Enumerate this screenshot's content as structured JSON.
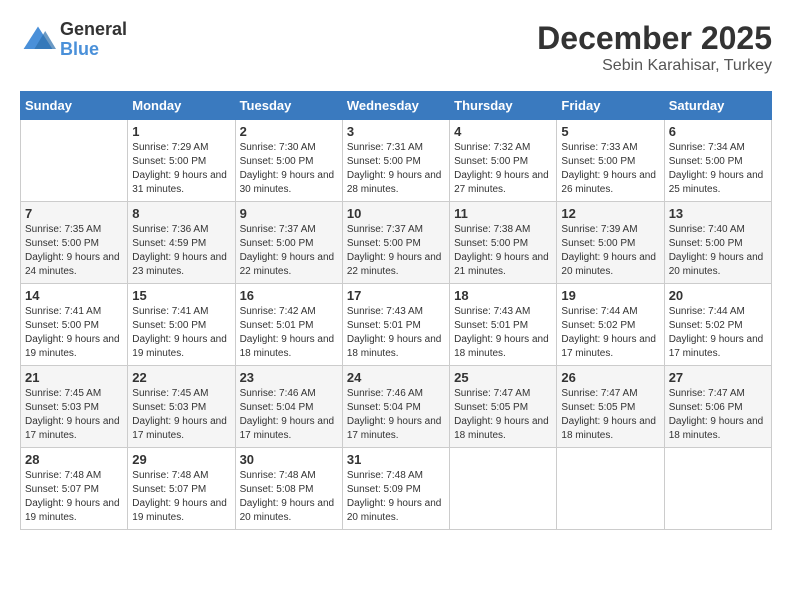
{
  "header": {
    "logo_general": "General",
    "logo_blue": "Blue",
    "title": "December 2025",
    "subtitle": "Sebin Karahisar, Turkey"
  },
  "weekdays": [
    "Sunday",
    "Monday",
    "Tuesday",
    "Wednesday",
    "Thursday",
    "Friday",
    "Saturday"
  ],
  "weeks": [
    [
      {
        "day": "",
        "sunrise": "",
        "sunset": "",
        "daylight": ""
      },
      {
        "day": "1",
        "sunrise": "Sunrise: 7:29 AM",
        "sunset": "Sunset: 5:00 PM",
        "daylight": "Daylight: 9 hours and 31 minutes."
      },
      {
        "day": "2",
        "sunrise": "Sunrise: 7:30 AM",
        "sunset": "Sunset: 5:00 PM",
        "daylight": "Daylight: 9 hours and 30 minutes."
      },
      {
        "day": "3",
        "sunrise": "Sunrise: 7:31 AM",
        "sunset": "Sunset: 5:00 PM",
        "daylight": "Daylight: 9 hours and 28 minutes."
      },
      {
        "day": "4",
        "sunrise": "Sunrise: 7:32 AM",
        "sunset": "Sunset: 5:00 PM",
        "daylight": "Daylight: 9 hours and 27 minutes."
      },
      {
        "day": "5",
        "sunrise": "Sunrise: 7:33 AM",
        "sunset": "Sunset: 5:00 PM",
        "daylight": "Daylight: 9 hours and 26 minutes."
      },
      {
        "day": "6",
        "sunrise": "Sunrise: 7:34 AM",
        "sunset": "Sunset: 5:00 PM",
        "daylight": "Daylight: 9 hours and 25 minutes."
      }
    ],
    [
      {
        "day": "7",
        "sunrise": "Sunrise: 7:35 AM",
        "sunset": "Sunset: 5:00 PM",
        "daylight": "Daylight: 9 hours and 24 minutes."
      },
      {
        "day": "8",
        "sunrise": "Sunrise: 7:36 AM",
        "sunset": "Sunset: 4:59 PM",
        "daylight": "Daylight: 9 hours and 23 minutes."
      },
      {
        "day": "9",
        "sunrise": "Sunrise: 7:37 AM",
        "sunset": "Sunset: 5:00 PM",
        "daylight": "Daylight: 9 hours and 22 minutes."
      },
      {
        "day": "10",
        "sunrise": "Sunrise: 7:37 AM",
        "sunset": "Sunset: 5:00 PM",
        "daylight": "Daylight: 9 hours and 22 minutes."
      },
      {
        "day": "11",
        "sunrise": "Sunrise: 7:38 AM",
        "sunset": "Sunset: 5:00 PM",
        "daylight": "Daylight: 9 hours and 21 minutes."
      },
      {
        "day": "12",
        "sunrise": "Sunrise: 7:39 AM",
        "sunset": "Sunset: 5:00 PM",
        "daylight": "Daylight: 9 hours and 20 minutes."
      },
      {
        "day": "13",
        "sunrise": "Sunrise: 7:40 AM",
        "sunset": "Sunset: 5:00 PM",
        "daylight": "Daylight: 9 hours and 20 minutes."
      }
    ],
    [
      {
        "day": "14",
        "sunrise": "Sunrise: 7:41 AM",
        "sunset": "Sunset: 5:00 PM",
        "daylight": "Daylight: 9 hours and 19 minutes."
      },
      {
        "day": "15",
        "sunrise": "Sunrise: 7:41 AM",
        "sunset": "Sunset: 5:00 PM",
        "daylight": "Daylight: 9 hours and 19 minutes."
      },
      {
        "day": "16",
        "sunrise": "Sunrise: 7:42 AM",
        "sunset": "Sunset: 5:01 PM",
        "daylight": "Daylight: 9 hours and 18 minutes."
      },
      {
        "day": "17",
        "sunrise": "Sunrise: 7:43 AM",
        "sunset": "Sunset: 5:01 PM",
        "daylight": "Daylight: 9 hours and 18 minutes."
      },
      {
        "day": "18",
        "sunrise": "Sunrise: 7:43 AM",
        "sunset": "Sunset: 5:01 PM",
        "daylight": "Daylight: 9 hours and 18 minutes."
      },
      {
        "day": "19",
        "sunrise": "Sunrise: 7:44 AM",
        "sunset": "Sunset: 5:02 PM",
        "daylight": "Daylight: 9 hours and 17 minutes."
      },
      {
        "day": "20",
        "sunrise": "Sunrise: 7:44 AM",
        "sunset": "Sunset: 5:02 PM",
        "daylight": "Daylight: 9 hours and 17 minutes."
      }
    ],
    [
      {
        "day": "21",
        "sunrise": "Sunrise: 7:45 AM",
        "sunset": "Sunset: 5:03 PM",
        "daylight": "Daylight: 9 hours and 17 minutes."
      },
      {
        "day": "22",
        "sunrise": "Sunrise: 7:45 AM",
        "sunset": "Sunset: 5:03 PM",
        "daylight": "Daylight: 9 hours and 17 minutes."
      },
      {
        "day": "23",
        "sunrise": "Sunrise: 7:46 AM",
        "sunset": "Sunset: 5:04 PM",
        "daylight": "Daylight: 9 hours and 17 minutes."
      },
      {
        "day": "24",
        "sunrise": "Sunrise: 7:46 AM",
        "sunset": "Sunset: 5:04 PM",
        "daylight": "Daylight: 9 hours and 17 minutes."
      },
      {
        "day": "25",
        "sunrise": "Sunrise: 7:47 AM",
        "sunset": "Sunset: 5:05 PM",
        "daylight": "Daylight: 9 hours and 18 minutes."
      },
      {
        "day": "26",
        "sunrise": "Sunrise: 7:47 AM",
        "sunset": "Sunset: 5:05 PM",
        "daylight": "Daylight: 9 hours and 18 minutes."
      },
      {
        "day": "27",
        "sunrise": "Sunrise: 7:47 AM",
        "sunset": "Sunset: 5:06 PM",
        "daylight": "Daylight: 9 hours and 18 minutes."
      }
    ],
    [
      {
        "day": "28",
        "sunrise": "Sunrise: 7:48 AM",
        "sunset": "Sunset: 5:07 PM",
        "daylight": "Daylight: 9 hours and 19 minutes."
      },
      {
        "day": "29",
        "sunrise": "Sunrise: 7:48 AM",
        "sunset": "Sunset: 5:07 PM",
        "daylight": "Daylight: 9 hours and 19 minutes."
      },
      {
        "day": "30",
        "sunrise": "Sunrise: 7:48 AM",
        "sunset": "Sunset: 5:08 PM",
        "daylight": "Daylight: 9 hours and 20 minutes."
      },
      {
        "day": "31",
        "sunrise": "Sunrise: 7:48 AM",
        "sunset": "Sunset: 5:09 PM",
        "daylight": "Daylight: 9 hours and 20 minutes."
      },
      {
        "day": "",
        "sunrise": "",
        "sunset": "",
        "daylight": ""
      },
      {
        "day": "",
        "sunrise": "",
        "sunset": "",
        "daylight": ""
      },
      {
        "day": "",
        "sunrise": "",
        "sunset": "",
        "daylight": ""
      }
    ]
  ]
}
